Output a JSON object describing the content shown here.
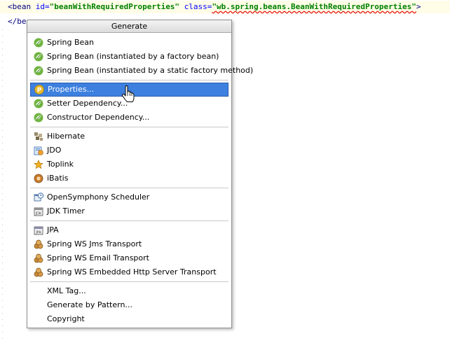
{
  "editor": {
    "line1": {
      "open": "<bean",
      "id_attr": "id=",
      "id_val": "\"beanWithRequiredProperties\"",
      "class_attr": "class=",
      "class_val": "\"wb.spring.beans.BeanWithRequiredProperties\"",
      "close": ">"
    },
    "line2_visible": "</be"
  },
  "popup": {
    "title": "Generate",
    "selected_item": "Properties...",
    "items": [
      {
        "label": "Spring Bean",
        "icon": "spring-leaf-icon"
      },
      {
        "label": "Spring Bean (instantiated by a factory bean)",
        "icon": "spring-leaf-icon"
      },
      {
        "label": "Spring Bean (instantiated by a static factory method)",
        "icon": "spring-leaf-icon"
      },
      {
        "label": "Properties...",
        "icon": "property-p-icon"
      },
      {
        "label": "Setter Dependency...",
        "icon": "spring-leaf-icon"
      },
      {
        "label": "Constructor Dependency...",
        "icon": "spring-leaf-icon"
      },
      {
        "label": "Hibernate",
        "icon": "hibernate-icon"
      },
      {
        "label": "JDO",
        "icon": "jdo-icon"
      },
      {
        "label": "Toplink",
        "icon": "toplink-icon"
      },
      {
        "label": "iBatis",
        "icon": "ibatis-icon"
      },
      {
        "label": "OpenSymphony Scheduler",
        "icon": "scheduler-icon"
      },
      {
        "label": "JDK Timer",
        "icon": "jdk-timer-icon"
      },
      {
        "label": "JPA",
        "icon": "jpa-icon"
      },
      {
        "label": "Spring WS Jms Transport",
        "icon": "ws-transport-icon"
      },
      {
        "label": "Spring WS Email Transport",
        "icon": "ws-transport-icon"
      },
      {
        "label": "Spring WS Embedded Http Server Transport",
        "icon": "ws-transport-icon"
      },
      {
        "label": "XML Tag...",
        "icon": ""
      },
      {
        "label": "Generate by Pattern...",
        "icon": ""
      },
      {
        "label": "Copyright",
        "icon": ""
      }
    ]
  },
  "colors": {
    "selection": "#3d80df",
    "spring_green": "#6db33f",
    "tag": "#000080",
    "attr": "#0000ff",
    "string": "#008000",
    "current_line": "#fffde7"
  }
}
